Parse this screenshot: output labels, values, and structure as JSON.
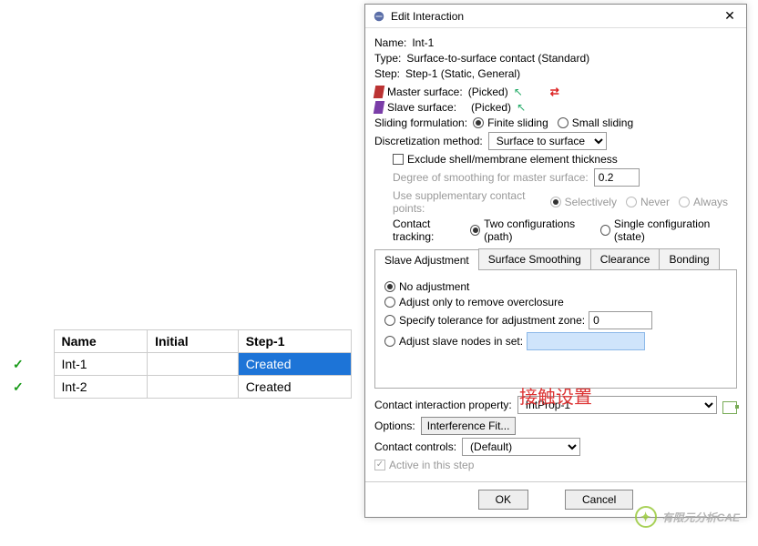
{
  "table": {
    "headers": {
      "name": "Name",
      "initial": "Initial",
      "step1": "Step-1"
    },
    "rows": [
      {
        "name": "Int-1",
        "initial": "",
        "step1": "Created",
        "selected_col": "step1"
      },
      {
        "name": "Int-2",
        "initial": "",
        "step1": "Created"
      }
    ]
  },
  "dialog": {
    "title": "Edit Interaction",
    "name_label": "Name:",
    "name_value": "Int-1",
    "type_label": "Type:",
    "type_value": "Surface-to-surface contact (Standard)",
    "step_label": "Step:",
    "step_value": "Step-1 (Static, General)",
    "master_label": "Master surface:",
    "master_value": "(Picked)",
    "slave_label": "Slave surface:",
    "slave_value": "(Picked)",
    "sliding_label": "Sliding formulation:",
    "sliding_opts": {
      "finite": "Finite sliding",
      "small": "Small sliding"
    },
    "discret_label": "Discretization method:",
    "discret_value": "Surface to surface",
    "exclude_label": "Exclude shell/membrane element thickness",
    "smooth_label": "Degree of smoothing for master surface:",
    "smooth_value": "0.2",
    "supp_label": "Use supplementary contact points:",
    "supp_opts": {
      "sel": "Selectively",
      "never": "Never",
      "always": "Always"
    },
    "track_label": "Contact tracking:",
    "track_opts": {
      "two": "Two configurations (path)",
      "single": "Single configuration (state)"
    },
    "tabs": {
      "slave": "Slave Adjustment",
      "smooth": "Surface Smoothing",
      "clear": "Clearance",
      "bond": "Bonding"
    },
    "slave_opts": {
      "none": "No adjustment",
      "over": "Adjust only to remove overclosure",
      "tol": "Specify tolerance for adjustment zone:",
      "tol_val": "0",
      "set": "Adjust slave nodes in set:"
    },
    "prop_label": "Contact interaction property:",
    "prop_value": "IntProp-1",
    "options_label": "Options:",
    "options_value": "Interference Fit...",
    "controls_label": "Contact controls:",
    "controls_value": "(Default)",
    "active_label": "Active in this step",
    "ok": "OK",
    "cancel": "Cancel"
  },
  "annotation": "接触设置",
  "watermark": "有限元分析CAE"
}
